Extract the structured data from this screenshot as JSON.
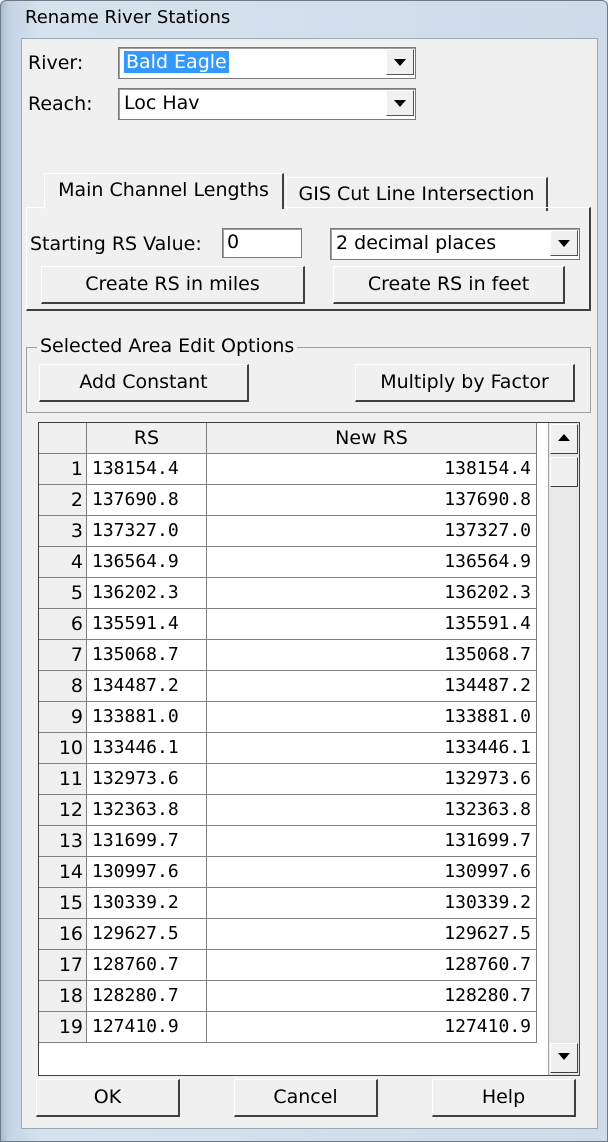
{
  "window": {
    "title": "Rename River Stations"
  },
  "river": {
    "label": "River:",
    "value": "Bald Eagle"
  },
  "reach": {
    "label": "Reach:",
    "value": "Loc Hav"
  },
  "tabs": [
    {
      "label": "Main Channel Lengths"
    },
    {
      "label": "GIS Cut Line Intersection"
    }
  ],
  "starting_rs": {
    "label": "Starting RS  Value:",
    "value": "0"
  },
  "decimals": {
    "value": "2 decimal places"
  },
  "buttons": {
    "create_miles": "Create RS in miles",
    "create_feet": "Create RS in feet",
    "add_constant": "Add Constant",
    "multiply": "Multiply by  Factor",
    "ok": "OK",
    "cancel": "Cancel",
    "help": "Help"
  },
  "edit_group": {
    "title": "Selected Area Edit Options"
  },
  "table": {
    "headers": [
      "",
      "RS",
      "New RS"
    ],
    "rows": [
      [
        "1",
        "138154.4",
        "138154.4"
      ],
      [
        "2",
        "137690.8",
        "137690.8"
      ],
      [
        "3",
        "137327.0",
        "137327.0"
      ],
      [
        "4",
        "136564.9",
        "136564.9"
      ],
      [
        "5",
        "136202.3",
        "136202.3"
      ],
      [
        "6",
        "135591.4",
        "135591.4"
      ],
      [
        "7",
        "135068.7",
        "135068.7"
      ],
      [
        "8",
        "134487.2",
        "134487.2"
      ],
      [
        "9",
        "133881.0",
        "133881.0"
      ],
      [
        "10",
        "133446.1",
        "133446.1"
      ],
      [
        "11",
        "132973.6",
        "132973.6"
      ],
      [
        "12",
        "132363.8",
        "132363.8"
      ],
      [
        "13",
        "131699.7",
        "131699.7"
      ],
      [
        "14",
        "130997.6",
        "130997.6"
      ],
      [
        "15",
        "130339.2",
        "130339.2"
      ],
      [
        "16",
        "129627.5",
        "129627.5"
      ],
      [
        "17",
        "128760.7",
        "128760.7"
      ],
      [
        "18",
        "128280.7",
        "128280.7"
      ],
      [
        "19",
        "127410.9",
        "127410.9"
      ]
    ]
  },
  "icons": {
    "dropdown": "chevron-down-icon",
    "scroll_up": "arrow-up-icon",
    "scroll_down": "arrow-down-icon"
  },
  "colors": {
    "selection": "#3399ff",
    "face": "#f0f0f0"
  }
}
